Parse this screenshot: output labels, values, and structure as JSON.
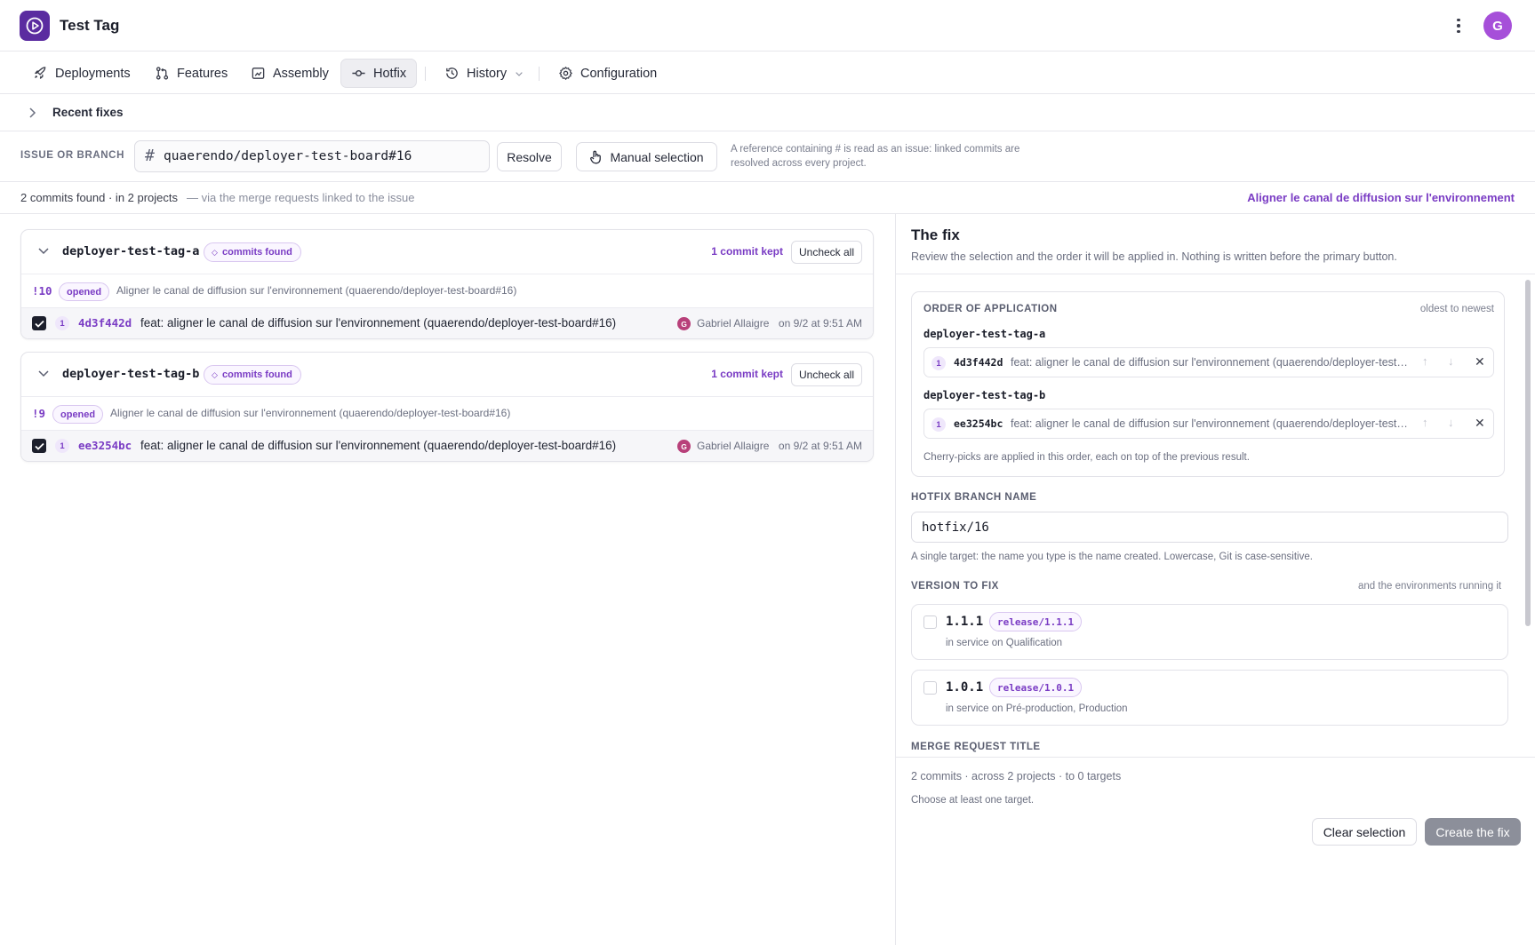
{
  "app": {
    "title": "Test Tag",
    "avatar_initial": "G"
  },
  "nav": {
    "deployments": "Deployments",
    "features": "Features",
    "assembly": "Assembly",
    "hotfix": "Hotfix",
    "history": "History",
    "configuration": "Configuration"
  },
  "recent": {
    "label": "Recent fixes"
  },
  "issue": {
    "label": "ISSUE OR BRANCH",
    "value": "quaerendo/deployer-test-board#16",
    "resolve": "Resolve",
    "manual": "Manual selection",
    "help": "A reference containing # is read as an issue: linked commits are resolved across every project."
  },
  "summary": {
    "count": "2 commits found · in 2 projects",
    "via": "—   via the merge requests linked to the issue",
    "link": "Aligner le canal de diffusion sur l'environnement"
  },
  "projects": [
    {
      "name": "deployer-test-tag-a",
      "badge": "commits found",
      "kept": "1 commit kept",
      "uncheck": "Uncheck all",
      "mr_id": "!10",
      "mr_status": "opened",
      "mr_title": "Aligner le canal de diffusion sur l'environnement (quaerendo/deployer-test-board#16)",
      "commit": {
        "index": "1",
        "sha": "4d3f442d",
        "message": "feat: aligner le canal de diffusion sur l'environnement (quaerendo/deployer-test-board#16)",
        "author_initial": "G",
        "author": "Gabriel Allaigre",
        "date": "on 9/2 at 9:51 AM",
        "checked": true
      }
    },
    {
      "name": "deployer-test-tag-b",
      "badge": "commits found",
      "kept": "1 commit kept",
      "uncheck": "Uncheck all",
      "mr_id": "!9",
      "mr_status": "opened",
      "mr_title": "Aligner le canal de diffusion sur l'environnement (quaerendo/deployer-test-board#16)",
      "commit": {
        "index": "1",
        "sha": "ee3254bc",
        "message": "feat: aligner le canal de diffusion sur l'environnement (quaerendo/deployer-test-board#16)",
        "author_initial": "G",
        "author": "Gabriel Allaigre",
        "date": "on 9/2 at 9:51 AM",
        "checked": true
      }
    }
  ],
  "fix": {
    "title": "The fix",
    "subtitle": "Review the selection and the order it will be applied in. Nothing is written before the primary button.",
    "order": {
      "label": "ORDER OF APPLICATION",
      "hint": "oldest to newest",
      "items": [
        {
          "project": "deployer-test-tag-a",
          "index": "1",
          "sha": "4d3f442d",
          "message": "feat: aligner le canal de diffusion sur l'environnement (quaerendo/deployer-test-board#16)"
        },
        {
          "project": "deployer-test-tag-b",
          "index": "1",
          "sha": "ee3254bc",
          "message": "feat: aligner le canal de diffusion sur l'environnement (quaerendo/deployer-test-board#16)"
        }
      ],
      "note": "Cherry-picks are applied in this order, each on top of the previous result."
    },
    "branch": {
      "label": "HOTFIX BRANCH NAME",
      "value": "hotfix/16",
      "help": "A single target: the name you type is the name created. Lowercase, Git is case-sensitive."
    },
    "version": {
      "label": "VERSION TO FIX",
      "hint": "and the environments running it",
      "items": [
        {
          "version": "1.1.1",
          "tag": "release/1.1.1",
          "env": "in service on Qualification",
          "checked": false
        },
        {
          "version": "1.0.1",
          "tag": "release/1.0.1",
          "env": "in service on Pré-production, Production",
          "checked": false
        }
      ]
    },
    "mr_title_label": "MERGE REQUEST TITLE",
    "footer": {
      "summary": "2 commits · across 2 projects · to 0 targets",
      "warning": "Choose at least one target.",
      "clear": "Clear selection",
      "create": "Create the fix"
    }
  }
}
